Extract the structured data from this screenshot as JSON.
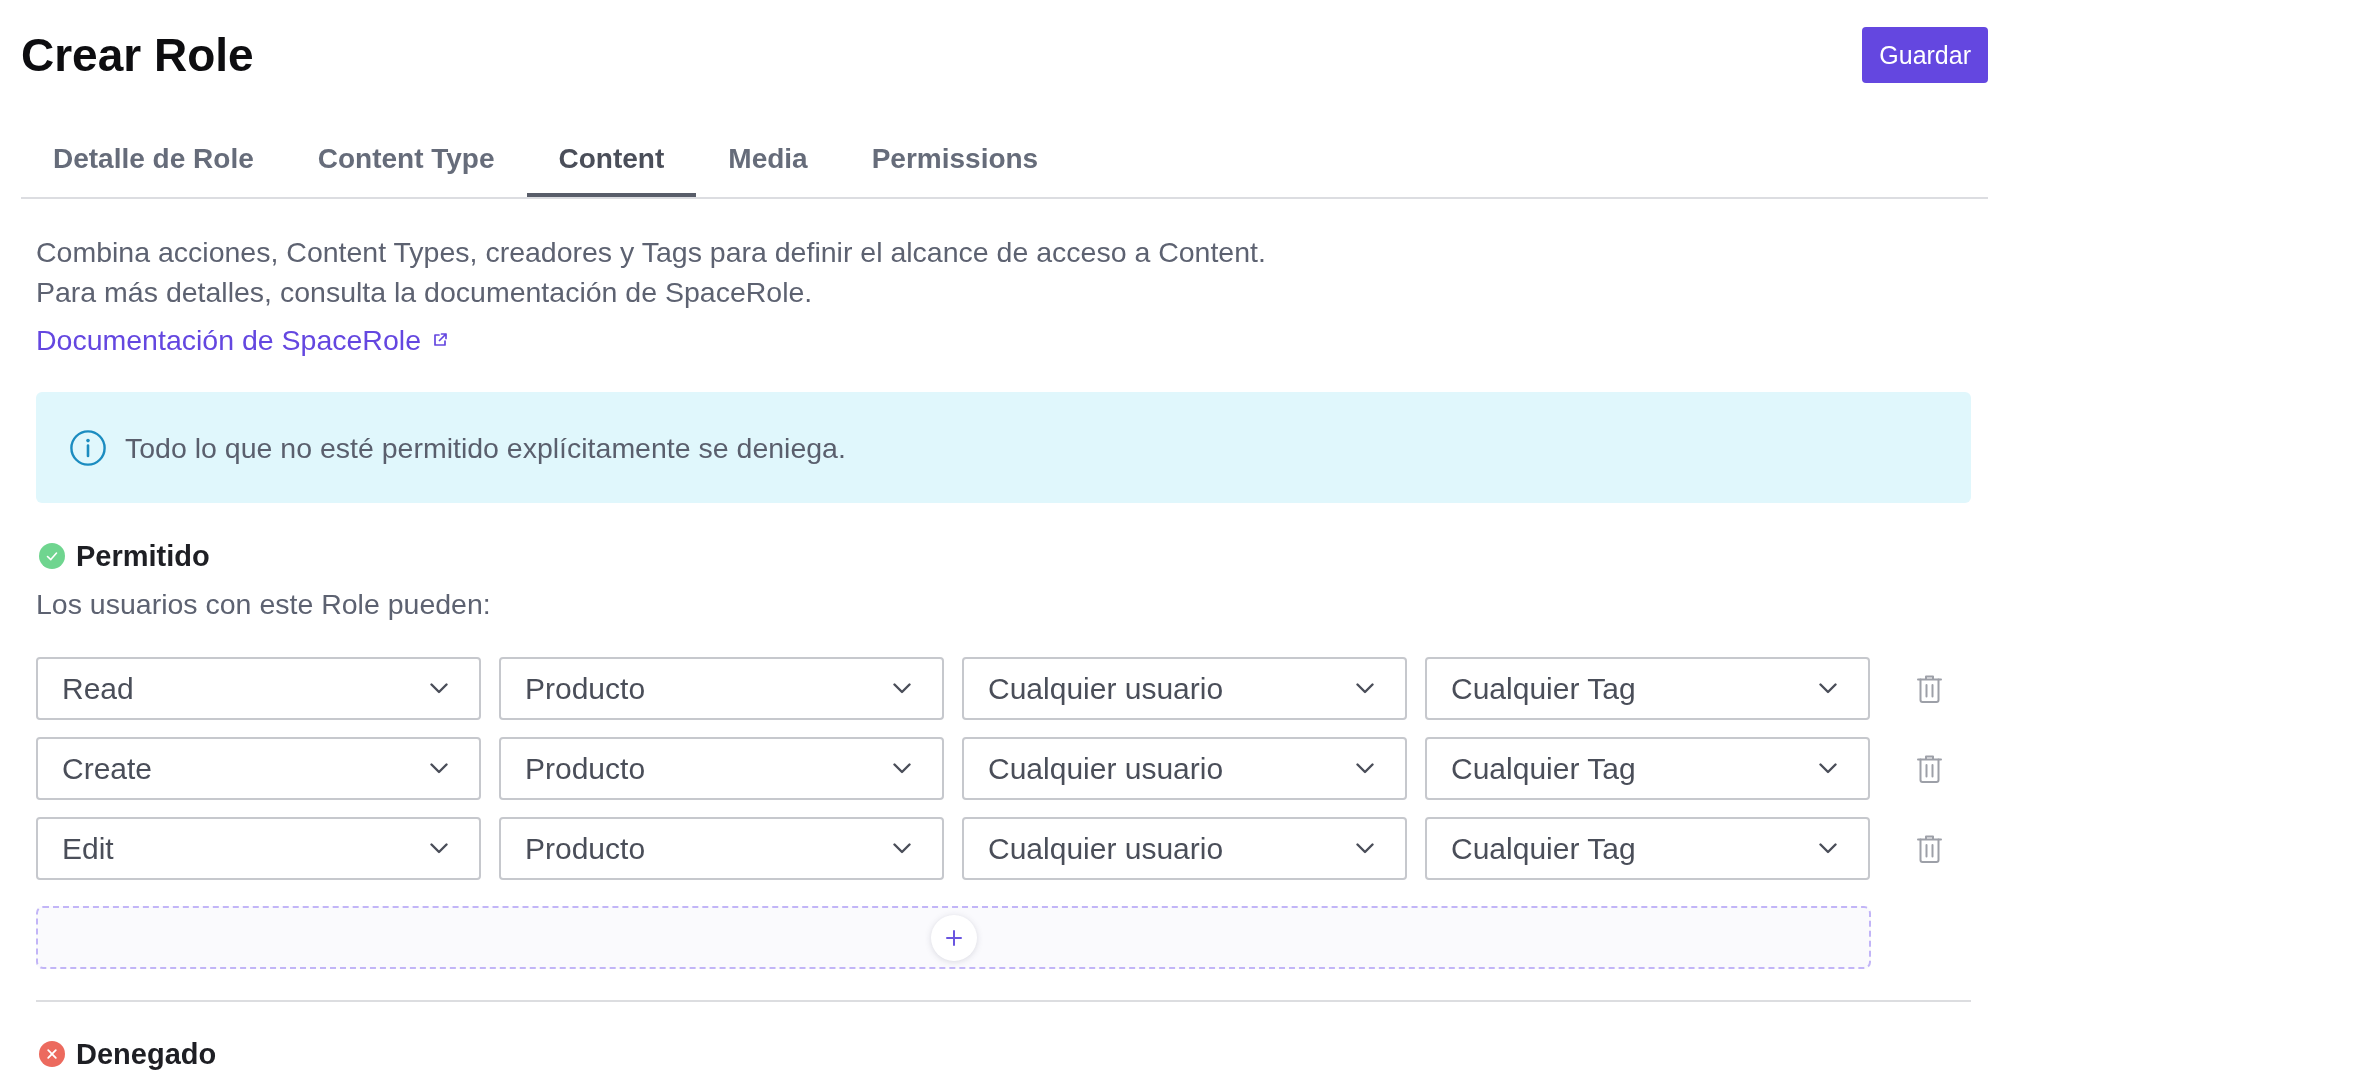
{
  "header": {
    "title": "Crear Role",
    "save_button": "Guardar"
  },
  "tabs": [
    {
      "label": "Detalle de Role",
      "selected": false
    },
    {
      "label": "Content Type",
      "selected": false
    },
    {
      "label": "Content",
      "selected": true
    },
    {
      "label": "Media",
      "selected": false
    },
    {
      "label": "Permissions",
      "selected": false
    }
  ],
  "intro": {
    "lines": [
      "Combina acciones, Content Types, creadores y Tags para definir el alcance de acceso a Content.",
      "Para más detalles, consulta la documentación de SpaceRole."
    ],
    "link": "Documentación de SpaceRole"
  },
  "notice": {
    "text": "Todo lo que no esté permitido explícitamente se deniega."
  },
  "sections": [
    {
      "kind": "allowed",
      "title": "Permitido",
      "subtitle": "Los usuarios con este Role pueden:",
      "rules": [
        {
          "action": "Read",
          "content_type": "Producto",
          "creator": "Cualquier usuario",
          "tag": "Cualquier Tag"
        },
        {
          "action": "Create",
          "content_type": "Producto",
          "creator": "Cualquier usuario",
          "tag": "Cualquier Tag"
        },
        {
          "action": "Edit",
          "content_type": "Producto",
          "creator": "Cualquier usuario",
          "tag": "Cualquier Tag"
        }
      ]
    },
    {
      "kind": "denied",
      "title": "Denegado"
    }
  ]
}
